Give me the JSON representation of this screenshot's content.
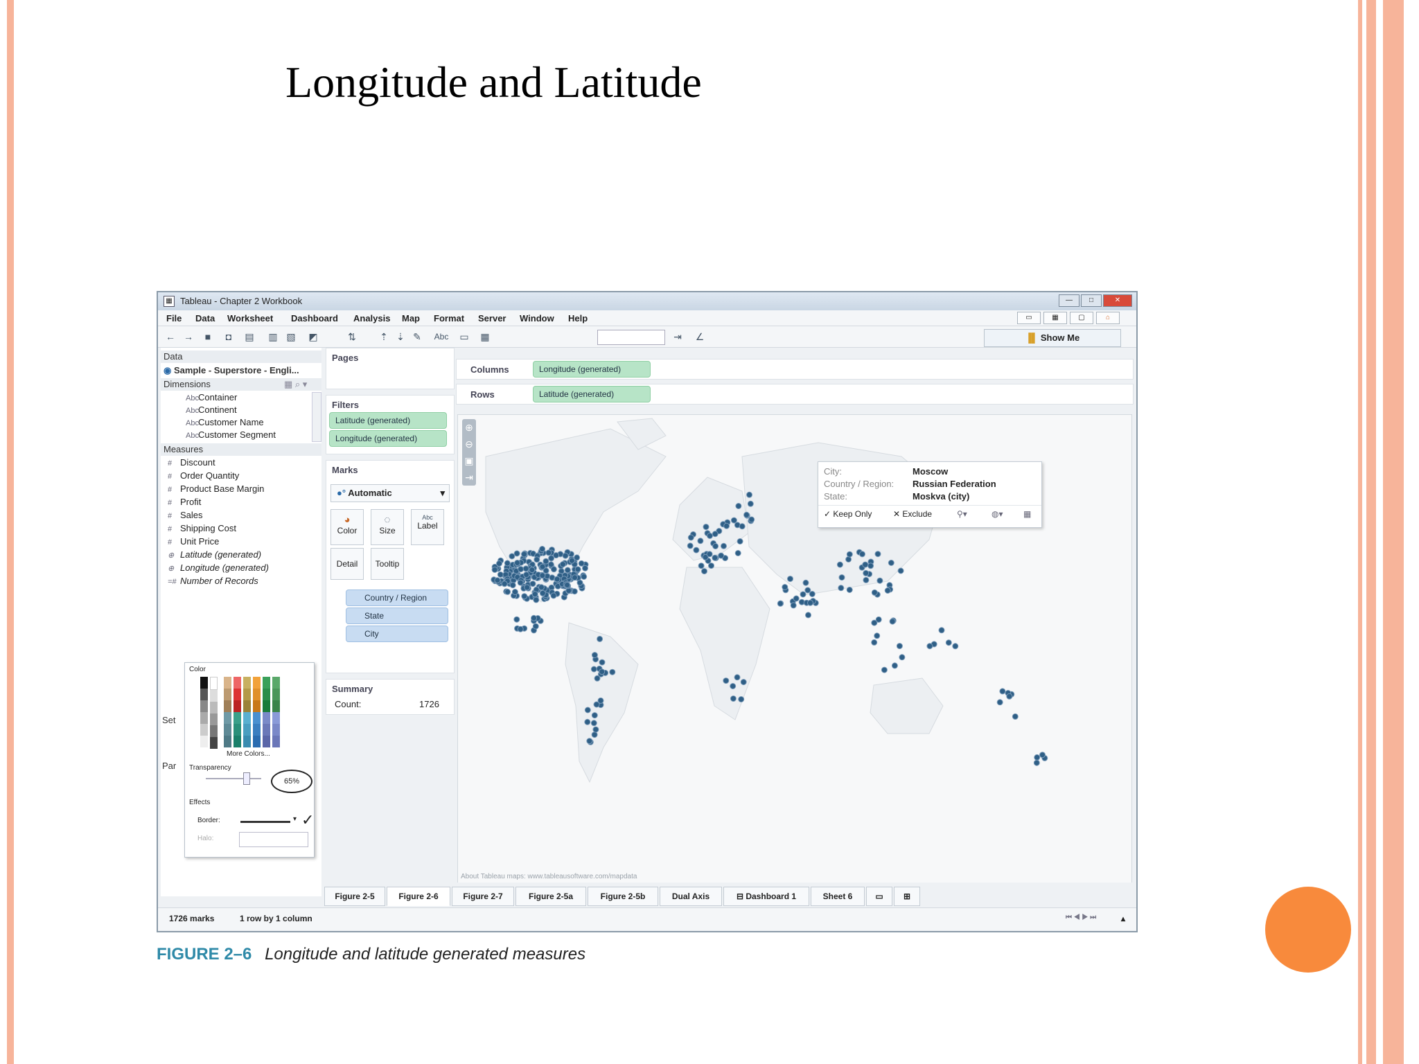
{
  "slide": {
    "title": "Longitude and Latitude"
  },
  "caption": {
    "figure": "FIGURE 2–6",
    "text": "Longitude and latitude generated measures"
  },
  "window": {
    "title": "Tableau - Chapter 2 Workbook"
  },
  "menu": [
    "File",
    "Data",
    "Worksheet",
    "Dashboard",
    "Analysis",
    "Map",
    "Format",
    "Server",
    "Window",
    "Help"
  ],
  "toolbar": {
    "show_me": "Show Me",
    "abc": "Abc"
  },
  "data_pane": {
    "header": "Data",
    "source": "Sample - Superstore - Engli...",
    "dimensions_label": "Dimensions",
    "dimensions": [
      "Container",
      "Continent",
      "Customer Name",
      "Customer Segment"
    ],
    "measures_label": "Measures",
    "measures": [
      "Discount",
      "Order Quantity",
      "Product Base Margin",
      "Profit",
      "Sales",
      "Shipping Cost",
      "Unit Price",
      "Latitude (generated)",
      "Longitude (generated)",
      "Number of Records"
    ],
    "partial_labels": [
      "Set",
      "Par"
    ]
  },
  "color_popup": {
    "title": "Color",
    "more_colors": "More Colors...",
    "transparency_label": "Transparency",
    "transparency_value": "65%",
    "effects_label": "Effects",
    "border_label": "Border:",
    "halo_label": "Halo:"
  },
  "pages": {
    "label": "Pages"
  },
  "filters": {
    "label": "Filters",
    "items": [
      "Latitude (generated)",
      "Longitude (generated)"
    ]
  },
  "marks": {
    "label": "Marks",
    "type": "Automatic",
    "buttons": [
      "Color",
      "Size",
      "Label",
      "Detail",
      "Tooltip"
    ],
    "detail_pills": [
      "Country / Region",
      "State",
      "City"
    ]
  },
  "summary": {
    "label": "Summary",
    "count_label": "Count:",
    "count_value": "1726"
  },
  "shelves": {
    "columns_label": "Columns",
    "columns_pill": "Longitude (generated)",
    "rows_label": "Rows",
    "rows_pill": "Latitude (generated)"
  },
  "map": {
    "attribution": "About Tableau maps: www.tableausoftware.com/mapdata",
    "tooltip": {
      "city_label": "City:",
      "city": "Moscow",
      "country_label": "Country / Region:",
      "country": "Russian Federation",
      "state_label": "State:",
      "state": "Moskva (city)",
      "keep_only": "Keep Only",
      "exclude": "Exclude"
    }
  },
  "tabs": [
    "Figure 2-5",
    "Figure 2-6",
    "Figure 2-7",
    "Figure 2-5a",
    "Figure 2-5b",
    "Dual Axis",
    "Dashboard 1",
    "Sheet 6"
  ],
  "active_tab": "Figure 2-6",
  "status": {
    "marks": "1726 marks",
    "layout": "1 row by 1 column"
  },
  "colors": {
    "accent_stripe": "#f7b49a",
    "orange_circle": "#f88a3c",
    "pill_green": "#b7e4c7",
    "pill_blue": "#c8dcf2",
    "mark_dot": "#2f5f86",
    "caption_blue": "#2f8aa8"
  }
}
